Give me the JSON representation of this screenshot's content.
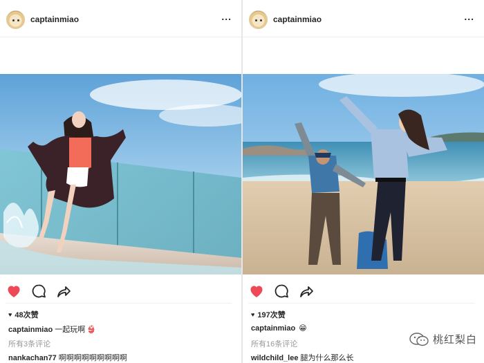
{
  "posts": [
    {
      "username": "captainmiao",
      "more_label": "...",
      "likes": "48次赞",
      "caption_user": "captainmiao",
      "caption_text": "一起玩啊",
      "caption_emoji": "👙",
      "view_comments": "所有3条评论",
      "comment_user": "nankachan77",
      "comment_text": "啊啊啊啊啊啊啊啊啊"
    },
    {
      "username": "captainmiao",
      "more_label": "...",
      "likes": "197次赞",
      "caption_user": "captainmiao",
      "caption_text": "",
      "caption_emoji": "😁",
      "view_comments": "所有16条评论",
      "comment_user": "wildchild_lee",
      "comment_text": "腿为什么那么长"
    }
  ],
  "watermark": {
    "text": "桃红梨白"
  },
  "colors": {
    "like_red": "#ed4956",
    "text": "#262626",
    "muted": "#999999"
  },
  "icons": [
    "heart-filled-icon",
    "comment-bubble-icon",
    "share-arrow-icon",
    "more-dots-icon"
  ]
}
